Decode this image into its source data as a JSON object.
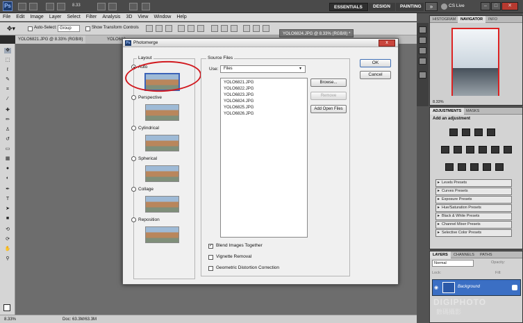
{
  "app": {
    "logo": "Ps",
    "zoom": "8.33",
    "workspaces": [
      "ESSENTIALS",
      "DESIGN",
      "PAINTING"
    ],
    "more": "»",
    "cs_live": "CS Live"
  },
  "menu": [
    "File",
    "Edit",
    "Image",
    "Layer",
    "Select",
    "Filter",
    "Analysis",
    "3D",
    "View",
    "Window",
    "Help"
  ],
  "options": {
    "auto_select": "Auto-Select:",
    "group": "Group",
    "show_transform": "Show Transform Controls"
  },
  "doc_tabs": {
    "tab1": "YOLO6821.JPG @ 8.33% (RGB/8)",
    "tab2": "YOLO682",
    "active": "YOLO6824.JPG @ 8.33% (RGB/8) *"
  },
  "status": {
    "zoom": "8.33%",
    "doc": "Doc: 63.3M/63.3M"
  },
  "panels": {
    "nav_tabs": [
      "HISTOGRAM",
      "NAVIGATOR",
      "INFO"
    ],
    "nav_zoom": "8.33%",
    "adj_tabs": [
      "ADJUSTMENTS",
      "MASKS"
    ],
    "adj_title": "Add an adjustment",
    "presets": [
      "Levels Presets",
      "Curves Presets",
      "Exposure Presets",
      "Hue/Saturation Presets",
      "Black & White Presets",
      "Channel Mixer Presets",
      "Selective Color Presets"
    ],
    "layers_tabs": [
      "LAYERS",
      "CHANNELS",
      "PATHS"
    ],
    "blend_mode": "Normal",
    "opacity": "Opacity:",
    "lock": "Lock:",
    "fill": "Fill:",
    "layer_name": "Background"
  },
  "watermark": "DIGIPHOTO",
  "watermark_sub": "數碼攝影",
  "dialog": {
    "title": "Photomerge",
    "layout_label": "Layout",
    "layouts": [
      "Auto",
      "Perspective",
      "Cylindrical",
      "Spherical",
      "Collage",
      "Reposition"
    ],
    "selected_layout": "Auto",
    "source_label": "Source Files",
    "use_label": "Use:",
    "use_value": "Files",
    "files": [
      "YOLO6821.JPG",
      "YOLO6822.JPG",
      "YOLO6823.JPG",
      "YOLO6824.JPG",
      "YOLO6825.JPG",
      "YOLO6826.JPG"
    ],
    "browse": "Browse...",
    "remove": "Remove",
    "add_open": "Add Open Files",
    "ok": "OK",
    "cancel": "Cancel",
    "options": [
      {
        "label": "Blend Images Together",
        "checked": true
      },
      {
        "label": "Vignette Removal",
        "checked": false
      },
      {
        "label": "Geometric Distortion Correction",
        "checked": false
      }
    ],
    "close": "x"
  }
}
